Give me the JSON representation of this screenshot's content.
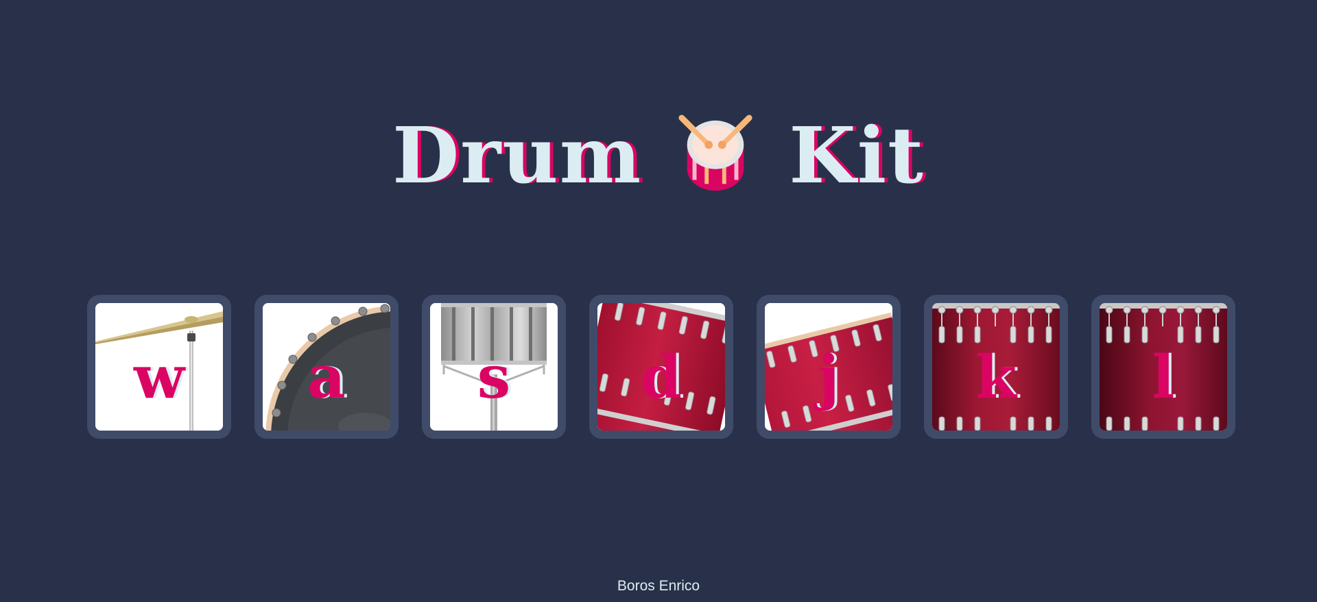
{
  "header": {
    "title_left": "Drum",
    "title_right": "Kit",
    "title_icon": "drum-icon"
  },
  "pads": [
    {
      "key": "w",
      "instrument_icon": "crash-cymbal-icon"
    },
    {
      "key": "a",
      "instrument_icon": "kick-drum-icon"
    },
    {
      "key": "s",
      "instrument_icon": "snare-drum-icon"
    },
    {
      "key": "d",
      "instrument_icon": "tom-1-icon"
    },
    {
      "key": "j",
      "instrument_icon": "tom-2-icon"
    },
    {
      "key": "k",
      "instrument_icon": "tom-3-icon"
    },
    {
      "key": "l",
      "instrument_icon": "tom-4-icon"
    }
  ],
  "footer": {
    "author": "Boros Enrico"
  },
  "colors": {
    "background": "#283149",
    "pad_frame": "#404B69",
    "accent": "#DA0463",
    "light": "#DBEDF3"
  }
}
